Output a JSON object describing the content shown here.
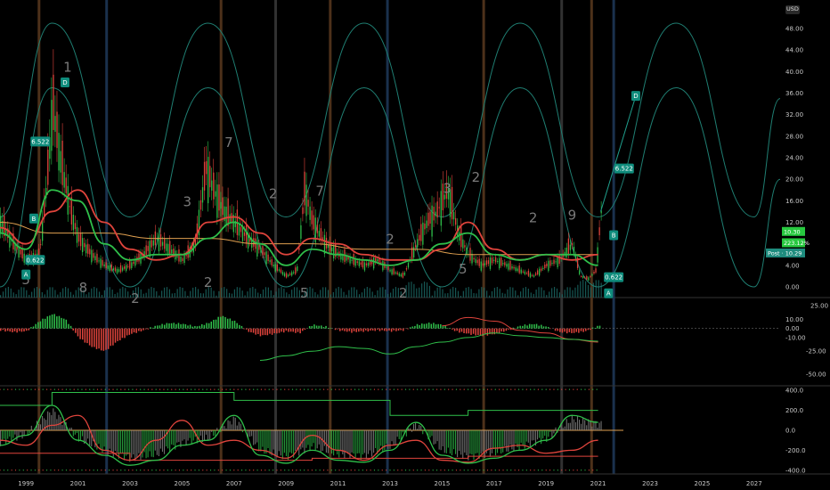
{
  "currency": "USD",
  "chart_data": [
    {
      "type": "line",
      "panel": "price",
      "y_ticks": [
        "48.00",
        "44.00",
        "40.00",
        "36.00",
        "32.00",
        "28.00",
        "24.00",
        "20.00",
        "16.00",
        "12.00",
        "8.00",
        "4.00",
        "0.00"
      ],
      "ylim": [
        0,
        50
      ],
      "x_ticks": [
        "1999",
        "2001",
        "2003",
        "2005",
        "2007",
        "2009",
        "2011",
        "2013",
        "2015",
        "2017",
        "2019",
        "2021",
        "2023",
        "2025",
        "2027"
      ],
      "xlim": [
        1998,
        2028
      ],
      "price_series": {
        "x": [
          1998.0,
          1998.5,
          1999.0,
          1999.5,
          1999.8,
          2000.0,
          2000.3,
          2000.7,
          2001.0,
          2001.5,
          2002.0,
          2002.5,
          2003.0,
          2003.5,
          2004.0,
          2004.5,
          2005.0,
          2005.5,
          2005.9,
          2006.2,
          2006.6,
          2007.0,
          2007.5,
          2008.0,
          2008.5,
          2009.0,
          2009.4,
          2009.7,
          2010.0,
          2010.5,
          2011.0,
          2011.5,
          2012.0,
          2012.5,
          2013.0,
          2013.5,
          2014.0,
          2014.4,
          2014.8,
          2015.2,
          2015.6,
          2016.0,
          2016.5,
          2017.0,
          2017.5,
          2018.0,
          2018.5,
          2019.0,
          2019.5,
          2020.0,
          2020.3,
          2020.6,
          2020.9,
          2021.1
        ],
        "y": [
          12,
          8,
          5,
          6,
          20,
          34,
          24,
          14,
          9,
          6,
          4,
          3,
          4,
          6,
          9,
          7,
          5,
          8,
          22,
          18,
          14,
          12,
          9,
          7,
          4,
          2,
          3,
          18,
          12,
          8,
          6,
          5,
          4,
          5,
          3,
          2,
          8,
          12,
          14,
          18,
          10,
          6,
          4,
          5,
          4,
          3,
          2,
          4,
          5,
          8,
          2,
          1.5,
          3,
          14
        ]
      },
      "cycle_upper": {
        "x": [
          1998,
          2000,
          2003,
          2006,
          2009,
          2012,
          2015,
          2018,
          2021,
          2024,
          2027,
          2028
        ],
        "y": [
          13,
          49,
          13,
          49,
          13,
          49,
          13,
          49,
          13,
          49,
          13,
          35
        ]
      },
      "cycle_lower": {
        "x": [
          1998,
          2000,
          2003,
          2006,
          2009,
          2012,
          2015,
          2018,
          2021,
          2024,
          2027,
          2028
        ],
        "y": [
          0,
          37,
          0,
          37,
          0,
          37,
          0,
          37,
          0,
          37,
          0,
          20
        ]
      },
      "ma_fast": {
        "x": [
          1998,
          1999,
          2000,
          2001,
          2002,
          2003,
          2004,
          2005,
          2006,
          2007,
          2008,
          2009,
          2010,
          2011,
          2012,
          2013,
          2014,
          2015,
          2016,
          2017,
          2018,
          2019,
          2020,
          2021
        ],
        "y": [
          10,
          7,
          18,
          16,
          8,
          5,
          6,
          6,
          9,
          12,
          8,
          4,
          7,
          6,
          5,
          4,
          5,
          8,
          10,
          6,
          5,
          6,
          6,
          4
        ]
      },
      "ma_slow": {
        "x": [
          1998,
          1999,
          2000,
          2001,
          2002,
          2003,
          2004,
          2005,
          2006,
          2007,
          2008,
          2009,
          2010,
          2011,
          2012,
          2013,
          2014,
          2015,
          2016,
          2017,
          2018,
          2019,
          2020,
          2021
        ],
        "y": [
          11,
          8,
          14,
          18,
          12,
          7,
          5,
          6,
          12,
          13,
          10,
          6,
          9,
          8,
          6,
          5,
          5,
          7,
          12,
          7,
          5,
          6,
          5,
          6
        ]
      },
      "ma_long": {
        "x": [
          1998,
          2000,
          2002,
          2004,
          2006,
          2008,
          2010,
          2012,
          2014,
          2016,
          2018,
          2020,
          2021
        ],
        "y": [
          12,
          10,
          10,
          9,
          9,
          8,
          8,
          7,
          7,
          6,
          6,
          6,
          6
        ]
      },
      "wave_labels": [
        {
          "x": 1999.0,
          "y": 0.5,
          "text": "5"
        },
        {
          "x": 2000.6,
          "y": 40,
          "text": "1"
        },
        {
          "x": 2001.2,
          "y": -1,
          "text": "8"
        },
        {
          "x": 2003.2,
          "y": -3,
          "text": "2"
        },
        {
          "x": 2005.2,
          "y": 15,
          "text": "3"
        },
        {
          "x": 2006.0,
          "y": 0,
          "text": "2"
        },
        {
          "x": 2006.8,
          "y": 26,
          "text": "7"
        },
        {
          "x": 2008.5,
          "y": 16.5,
          "text": "2"
        },
        {
          "x": 2009.7,
          "y": -2,
          "text": "5"
        },
        {
          "x": 2010.3,
          "y": 17,
          "text": "7"
        },
        {
          "x": 2013.0,
          "y": 8,
          "text": "2"
        },
        {
          "x": 2013.5,
          "y": -2,
          "text": "2"
        },
        {
          "x": 2015.2,
          "y": 17.5,
          "text": "3"
        },
        {
          "x": 2015.8,
          "y": 2.5,
          "text": "5"
        },
        {
          "x": 2016.3,
          "y": 19.5,
          "text": "2"
        },
        {
          "x": 2018.5,
          "y": 12,
          "text": "2"
        },
        {
          "x": 2020.0,
          "y": 12.5,
          "text": "9"
        }
      ],
      "tags": [
        {
          "x": 1999.55,
          "y": 27,
          "text": "6.522",
          "color": "#0f8c7c"
        },
        {
          "x": 2000.5,
          "y": 38,
          "text": "D",
          "color": "#0f8c7c"
        },
        {
          "x": 1999.3,
          "y": 12.7,
          "text": "B",
          "color": "#0f8c7c"
        },
        {
          "x": 1999.35,
          "y": 5,
          "text": "0.622",
          "color": "#0f8c7c"
        },
        {
          "x": 1999.0,
          "y": 2.3,
          "text": "A",
          "color": "#0f8c7c"
        },
        {
          "x": 2022.0,
          "y": 22,
          "text": "6.522",
          "color": "#0f8c7c"
        },
        {
          "x": 2022.45,
          "y": 35.5,
          "text": "D",
          "color": "#0f8c7c"
        },
        {
          "x": 2021.6,
          "y": 9.6,
          "text": "B",
          "color": "#0f8c7c"
        },
        {
          "x": 2021.6,
          "y": 1.8,
          "text": "0.622",
          "color": "#0f8c7c"
        },
        {
          "x": 2021.4,
          "y": -1.2,
          "text": "A",
          "color": "#0f8c7c"
        }
      ],
      "price_labels": [
        {
          "text": "10.30",
          "color": "#27c93f",
          "y": 10.3
        },
        {
          "text": "223.12%",
          "color": "#27c93f",
          "y": 8.2
        },
        {
          "text": "Post · 10.29",
          "color": "#1e8c7e",
          "y": 6.3
        }
      ],
      "cycle_markers": [
        {
          "x": 1999.5,
          "color": "#5b3a1e"
        },
        {
          "x": 2002.1,
          "color": "#1e3a5b"
        },
        {
          "x": 2006.5,
          "color": "#5b3a1e"
        },
        {
          "x": 2008.6,
          "color": "#3a3a3a"
        },
        {
          "x": 2010.7,
          "color": "#5b3a1e"
        },
        {
          "x": 2012.9,
          "color": "#1e3a5b"
        },
        {
          "x": 2016.6,
          "color": "#5b3a1e"
        },
        {
          "x": 2019.6,
          "color": "#3a3a3a"
        },
        {
          "x": 2020.75,
          "color": "#5b3a1e"
        },
        {
          "x": 2021.6,
          "color": "#1e3a5b"
        }
      ]
    },
    {
      "type": "bar",
      "panel": "oscillator",
      "y_ticks": [
        "25.00",
        "10.00",
        "0.00",
        "-10.00",
        "-25.00",
        "-50.00"
      ],
      "ylim": [
        -60,
        30
      ],
      "histogram": {
        "x": [
          1998,
          1998.5,
          1999,
          1999.5,
          2000,
          2000.5,
          2001,
          2001.5,
          2002,
          2002.5,
          2003,
          2003.5,
          2004,
          2004.5,
          2005,
          2005.5,
          2006,
          2006.5,
          2007,
          2007.5,
          2008,
          2008.5,
          2009,
          2009.5,
          2010,
          2010.5,
          2011,
          2011.5,
          2012,
          2012.5,
          2013,
          2013.5,
          2014,
          2014.5,
          2015,
          2015.5,
          2016,
          2016.5,
          2017,
          2017.5,
          2018,
          2018.5,
          2019,
          2019.5,
          2020,
          2020.5,
          2021
        ],
        "y": [
          -2,
          -4,
          -3,
          8,
          16,
          10,
          -10,
          -20,
          -25,
          -14,
          -6,
          -2,
          3,
          6,
          5,
          2,
          6,
          14,
          8,
          -3,
          -8,
          -6,
          -3,
          -5,
          4,
          2,
          -2,
          -4,
          -3,
          -2,
          -3,
          -2,
          4,
          6,
          4,
          -3,
          -6,
          -8,
          -6,
          -2,
          3,
          5,
          2,
          -4,
          -5,
          -3,
          3
        ]
      },
      "signal_line": {
        "x": [
          2015,
          2016,
          2017,
          2018,
          2019,
          2020,
          2021
        ],
        "y": [
          3,
          12,
          8,
          -2,
          -5,
          -12,
          -15
        ]
      },
      "green_line": {
        "x": [
          2008,
          2009,
          2010,
          2011,
          2012,
          2013,
          2014,
          2015,
          2016,
          2017,
          2018,
          2019,
          2020,
          2021
        ],
        "y": [
          -35,
          -30,
          -25,
          -20,
          -22,
          -28,
          -20,
          -15,
          -10,
          -5,
          -8,
          -10,
          -12,
          -14
        ]
      }
    },
    {
      "type": "bar",
      "panel": "momentum",
      "y_ticks": [
        "400.0",
        "200.0",
        "0.0",
        "-200.0",
        "-400.0"
      ],
      "ylim": [
        -420,
        420
      ],
      "upper_step": {
        "x": [
          1998,
          2000,
          2000,
          2007,
          2007,
          2013,
          2013,
          2016,
          2016,
          2021
        ],
        "y": [
          250,
          250,
          380,
          380,
          300,
          300,
          150,
          150,
          200,
          200
        ]
      },
      "lower_step": {
        "x": [
          1998,
          2003,
          2003,
          2010,
          2010,
          2016,
          2016,
          2021
        ],
        "y": [
          -230,
          -230,
          -300,
          -300,
          -280,
          -280,
          -260,
          -260
        ]
      },
      "red_line": {
        "x": [
          1998,
          1999,
          2000,
          2001,
          2002,
          2003,
          2004,
          2005,
          2006,
          2007,
          2008,
          2009,
          2010,
          2011,
          2012,
          2013,
          2014,
          2015,
          2016,
          2017,
          2018,
          2019,
          2020,
          2021
        ],
        "y": [
          -100,
          -150,
          50,
          150,
          -200,
          -300,
          -100,
          100,
          -150,
          -100,
          -200,
          -280,
          -50,
          -200,
          -300,
          -150,
          -100,
          -300,
          -320,
          -180,
          -150,
          -230,
          -200,
          -100
        ]
      },
      "green_line": {
        "x": [
          1998,
          1999,
          2000,
          2001,
          2002,
          2003,
          2004,
          2005,
          2006,
          2007,
          2008,
          2009,
          2010,
          2011,
          2012,
          2013,
          2014,
          2015,
          2016,
          2017,
          2018,
          2019,
          2020,
          2021
        ],
        "y": [
          -150,
          -50,
          250,
          -100,
          -250,
          -350,
          -300,
          -150,
          -100,
          150,
          -250,
          -330,
          -200,
          -300,
          -320,
          -200,
          80,
          -250,
          -330,
          -280,
          -200,
          -100,
          150,
          80
        ]
      }
    }
  ]
}
